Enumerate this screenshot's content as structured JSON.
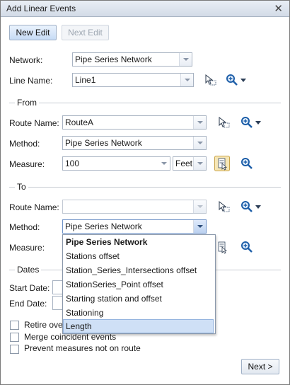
{
  "window": {
    "title": "Add Linear Events"
  },
  "toolbar": {
    "new_edit": "New Edit",
    "next_edit": "Next Edit"
  },
  "network": {
    "label": "Network:",
    "value": "Pipe Series Network"
  },
  "line_name": {
    "label": "Line Name:",
    "value": "Line1"
  },
  "from": {
    "title": "From",
    "route_label": "Route Name:",
    "route_value": "RouteA",
    "method_label": "Method:",
    "method_value": "Pipe Series Network",
    "measure_label": "Measure:",
    "measure_value": "100",
    "unit_value": "Feet"
  },
  "to": {
    "title": "To",
    "route_label": "Route Name:",
    "route_value": "",
    "method_label": "Method:",
    "method_value": "Pipe Series Network",
    "measure_label": "Measure:"
  },
  "dropdown_options": [
    "Pipe Series Network",
    "Stations offset",
    "Station_Series_Intersections offset",
    "StationSeries_Point offset",
    "Starting station and offset",
    "Stationing",
    "Length"
  ],
  "dates": {
    "title": "Dates",
    "start_label": "Start Date:",
    "end_label": "End Date:"
  },
  "options": {
    "retire": "Retire ove",
    "merge": "Merge coincident events",
    "prevent": "Prevent measures not on route"
  },
  "footer": {
    "next": "Next >"
  },
  "colors": {
    "accent": "#c6dbf5",
    "highlight": "#cfe0f6",
    "border": "#a8b3c2"
  }
}
